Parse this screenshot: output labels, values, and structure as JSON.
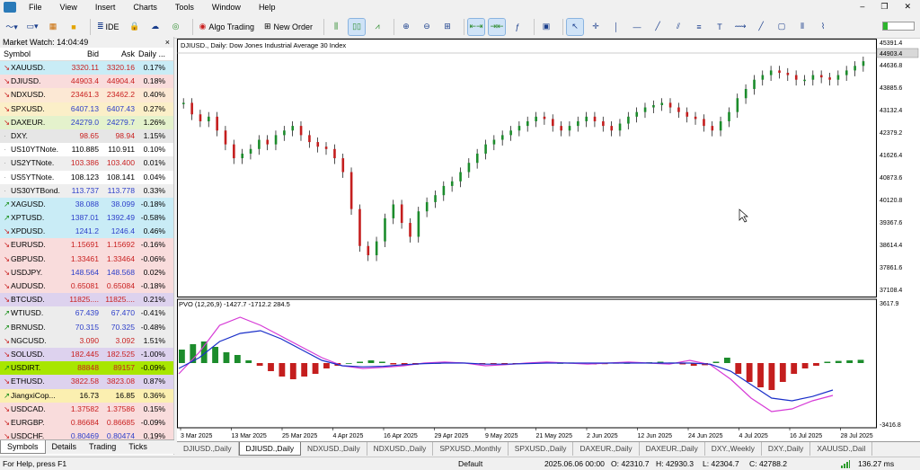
{
  "menu": [
    "File",
    "View",
    "Insert",
    "Charts",
    "Tools",
    "Window",
    "Help"
  ],
  "toolbar": {
    "ide_label": "IDE",
    "algo_label": "Algo Trading",
    "new_order_label": "New Order"
  },
  "market_watch": {
    "title": "Market Watch: 14:04:49",
    "close": "×",
    "columns": {
      "symbol": "Symbol",
      "bid": "Bid",
      "ask": "Ask",
      "daily": "Daily ..."
    },
    "rows": [
      {
        "dir": "down",
        "symbol": "XAUUSD.",
        "bid": "3320.11",
        "ask": "3320.16",
        "change": "0.17%",
        "bg": "#c9ecf6",
        "color": "#c92020"
      },
      {
        "dir": "down",
        "symbol": "DJIUSD.",
        "bid": "44903.4",
        "ask": "44904.4",
        "change": "0.18%",
        "bg": "#f9dcdc",
        "color": "#c92020"
      },
      {
        "dir": "down",
        "symbol": "NDXUSD.",
        "bid": "23461.3",
        "ask": "23462.2",
        "change": "0.40%",
        "bg": "#fce8d4",
        "color": "#c92020"
      },
      {
        "dir": "down",
        "symbol": "SPXUSD.",
        "bid": "6407.13",
        "ask": "6407.43",
        "change": "0.27%",
        "bg": "#fbefc8",
        "color": "#2c3ec9"
      },
      {
        "dir": "down",
        "symbol": "DAXEUR.",
        "bid": "24279.0",
        "ask": "24279.7",
        "change": "1.26%",
        "bg": "#e4f2cc",
        "color": "#2c3ec9"
      },
      {
        "dir": "idle",
        "symbol": "DXY.",
        "bid": "98.65",
        "ask": "98.94",
        "change": "1.15%",
        "bg": "#e6e6e6",
        "color": "#c92020"
      },
      {
        "dir": "idle",
        "symbol": "US10YTNote.",
        "bid": "110.885",
        "ask": "110.911",
        "change": "0.10%",
        "bg": "#ffffff",
        "color": "#000000"
      },
      {
        "dir": "idle",
        "symbol": "US2YTNote.",
        "bid": "103.386",
        "ask": "103.400",
        "change": "0.01%",
        "bg": "#eeeeee",
        "color": "#c92020"
      },
      {
        "dir": "idle",
        "symbol": "US5YTNote.",
        "bid": "108.123",
        "ask": "108.141",
        "change": "0.04%",
        "bg": "#ffffff",
        "color": "#000000"
      },
      {
        "dir": "idle",
        "symbol": "US30YTBond.",
        "bid": "113.737",
        "ask": "113.778",
        "change": "0.33%",
        "bg": "#eeeeee",
        "color": "#2c3ec9"
      },
      {
        "dir": "up",
        "symbol": "XAGUSD.",
        "bid": "38.088",
        "ask": "38.099",
        "change": "-0.18%",
        "bg": "#c9ecf6",
        "color": "#2c3ec9"
      },
      {
        "dir": "up",
        "symbol": "XPTUSD.",
        "bid": "1387.01",
        "ask": "1392.49",
        "change": "-0.58%",
        "bg": "#c9ecf6",
        "color": "#2c3ec9"
      },
      {
        "dir": "down",
        "symbol": "XPDUSD.",
        "bid": "1241.2",
        "ask": "1246.4",
        "change": "0.46%",
        "bg": "#c9ecf6",
        "color": "#2c3ec9"
      },
      {
        "dir": "down",
        "symbol": "EURUSD.",
        "bid": "1.15691",
        "ask": "1.15692",
        "change": "-0.16%",
        "bg": "#f9dcdc",
        "color": "#c92020"
      },
      {
        "dir": "down",
        "symbol": "GBPUSD.",
        "bid": "1.33461",
        "ask": "1.33464",
        "change": "-0.06%",
        "bg": "#f9dcdc",
        "color": "#c92020"
      },
      {
        "dir": "down",
        "symbol": "USDJPY.",
        "bid": "148.564",
        "ask": "148.568",
        "change": "0.02%",
        "bg": "#f9dcdc",
        "color": "#2c3ec9"
      },
      {
        "dir": "down",
        "symbol": "AUDUSD.",
        "bid": "0.65081",
        "ask": "0.65084",
        "change": "-0.18%",
        "bg": "#f9dcdc",
        "color": "#c92020"
      },
      {
        "dir": "down",
        "symbol": "BTCUSD.",
        "bid": "11825....",
        "ask": "11825....",
        "change": "0.21%",
        "bg": "#ddd2ee",
        "color": "#c92020"
      },
      {
        "dir": "up",
        "symbol": "WTIUSD.",
        "bid": "67.439",
        "ask": "67.470",
        "change": "-0.41%",
        "bg": "#ececec",
        "color": "#2c3ec9"
      },
      {
        "dir": "up",
        "symbol": "BRNUSD.",
        "bid": "70.315",
        "ask": "70.325",
        "change": "-0.48%",
        "bg": "#ececec",
        "color": "#2c3ec9"
      },
      {
        "dir": "down",
        "symbol": "NGCUSD.",
        "bid": "3.090",
        "ask": "3.092",
        "change": "1.51%",
        "bg": "#ececec",
        "color": "#c92020"
      },
      {
        "dir": "down",
        "symbol": "SOLUSD.",
        "bid": "182.445",
        "ask": "182.525",
        "change": "-1.00%",
        "bg": "#ddd2ee",
        "color": "#c92020"
      },
      {
        "dir": "up",
        "symbol": "USDIRT.",
        "bid": "88848",
        "ask": "89157",
        "change": "-0.09%",
        "bg": "#a8e600",
        "color": "#c92020"
      },
      {
        "dir": "down",
        "symbol": "ETHUSD.",
        "bid": "3822.58",
        "ask": "3823.08",
        "change": "0.87%",
        "bg": "#ddd2ee",
        "color": "#c92020"
      },
      {
        "dir": "up",
        "symbol": "JiangxiCop...",
        "bid": "16.73",
        "ask": "16.85",
        "change": "0.36%",
        "bg": "#fbefb0",
        "color": "#000000"
      },
      {
        "dir": "down",
        "symbol": "USDCAD.",
        "bid": "1.37582",
        "ask": "1.37586",
        "change": "0.15%",
        "bg": "#f9dcdc",
        "color": "#c92020"
      },
      {
        "dir": "down",
        "symbol": "EURGBP.",
        "bid": "0.86684",
        "ask": "0.86685",
        "change": "-0.09%",
        "bg": "#f9dcdc",
        "color": "#c92020"
      },
      {
        "dir": "down",
        "symbol": "USDCHF.",
        "bid": "0.80469",
        "ask": "0.80474",
        "change": "0.19%",
        "bg": "#f9dcdc",
        "color": "#2c3ec9"
      }
    ],
    "tabs": [
      "Symbols",
      "Details",
      "Trading",
      "Ticks"
    ]
  },
  "chart": {
    "title": "DJIUSD., Daily:  Dow Jones Industrial Average 30 Index",
    "indicator_title": "PVO (12,26,9) -1427.7 -1712.2 284.5",
    "price_labels": [
      "45391.4",
      "44636.8",
      "43885.6",
      "43132.4",
      "42379.2",
      "41626.4",
      "40873.6",
      "40120.8",
      "39367.6",
      "38614.4",
      "37861.6",
      "37108.4"
    ],
    "current_price": "44903.4",
    "indicator_labels": [
      "3617.9",
      "-3416.8"
    ],
    "date_labels": [
      "3 Mar 2025",
      "13 Mar 2025",
      "25 Mar 2025",
      "4 Apr 2025",
      "16 Apr 2025",
      "29 Apr 2025",
      "9 May 2025",
      "21 May 2025",
      "2 Jun 2025",
      "12 Jun 2025",
      "24 Jun 2025",
      "4 Jul 2025",
      "16 Jul 2025",
      "28 Jul 2025"
    ]
  },
  "bottom_tabs": [
    "DJIUSD.,Daily",
    "DJIUSD.,Daily",
    "NDXUSD.,Daily",
    "NDXUSD.,Daily",
    "SPXUSD.,Monthly",
    "SPXUSD.,Daily",
    "DAXEUR.,Daily",
    "DAXEUR.,Daily",
    "DXY.,Weekly",
    "DXY.,Daily",
    "XAUUSD.,Dail"
  ],
  "status": {
    "help": "For Help, press F1",
    "profile": "Default",
    "datetime": "2025.06.06 00:00",
    "open": "O: 42310.7",
    "high": "H: 42930.3",
    "low": "L: 42304.7",
    "close": "C: 42788.2",
    "ping": "136.27 ms"
  }
}
